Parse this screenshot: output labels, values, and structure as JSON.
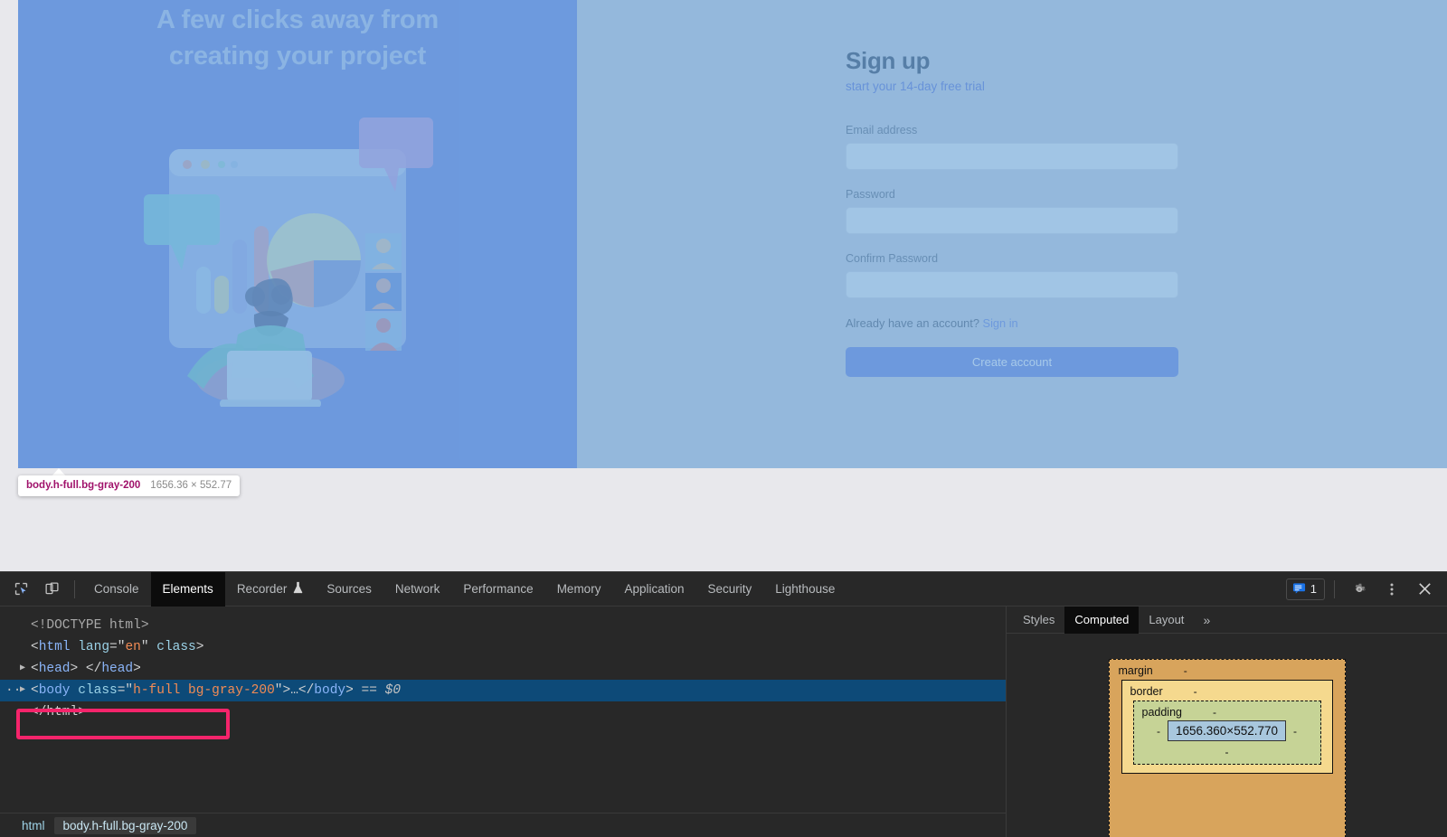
{
  "page": {
    "hero": {
      "title": "A few clicks away from creating your project",
      "illustration_name": "analytics-dashboard-illustration"
    },
    "signup": {
      "title": "Sign up",
      "subtitle": "start your 14-day free trial",
      "email_label": "Email address",
      "email_value": "",
      "email_placeholder": "",
      "password_label": "Password",
      "password_value": "",
      "password_placeholder": "",
      "confirm_label": "Confirm Password",
      "confirm_value": "",
      "confirm_placeholder": "",
      "already_text": "Already have an account?",
      "signin_link": "Sign in",
      "submit_label": "Create account"
    }
  },
  "highlight_tooltip": {
    "selector": "body.h-full.bg-gray-200",
    "dimensions": "1656.36 × 552.77"
  },
  "devtools": {
    "toolbar_icons": [
      "inspect-element-icon",
      "device-toolbar-icon"
    ],
    "tabs": [
      {
        "label": "Console",
        "active": false,
        "icon": ""
      },
      {
        "label": "Elements",
        "active": true,
        "icon": ""
      },
      {
        "label": "Recorder",
        "active": false,
        "icon": "flask-icon"
      },
      {
        "label": "Sources",
        "active": false,
        "icon": ""
      },
      {
        "label": "Network",
        "active": false,
        "icon": ""
      },
      {
        "label": "Performance",
        "active": false,
        "icon": ""
      },
      {
        "label": "Memory",
        "active": false,
        "icon": ""
      },
      {
        "label": "Application",
        "active": false,
        "icon": ""
      },
      {
        "label": "Security",
        "active": false,
        "icon": ""
      },
      {
        "label": "Lighthouse",
        "active": false,
        "icon": ""
      }
    ],
    "message_count": "1",
    "right_icons": [
      "message-icon",
      "settings-gear-icon",
      "more-options-icon",
      "close-icon"
    ],
    "dom": {
      "lines": [
        {
          "indent": 0,
          "twisty": "",
          "ellipsis": "",
          "text": "<!DOCTYPE html>",
          "type": "doctype",
          "selected": false
        },
        {
          "indent": 0,
          "twisty": "",
          "ellipsis": "",
          "text": "<html lang=\"en\" class>",
          "type": "tag",
          "selected": false
        },
        {
          "indent": 1,
          "twisty": "▶",
          "ellipsis": "",
          "text": "<head> </head>",
          "type": "tag",
          "selected": false
        },
        {
          "indent": 1,
          "twisty": "▶",
          "ellipsis": "··",
          "text": "<body class=\"h-full bg-gray-200\">…</body>  == $0",
          "type": "tag",
          "selected": true
        },
        {
          "indent": 0,
          "twisty": "",
          "ellipsis": "",
          "text": "</html>",
          "type": "tag",
          "selected": false
        }
      ],
      "doctype_text": "<!DOCTYPE html>",
      "html_open_tag": "html",
      "html_attr_name": "lang",
      "html_attr_value": "en",
      "html_attr_class": "class",
      "head_tag": "head",
      "body_tag": "body",
      "body_attr_name": "class",
      "body_attr_value": "h-full bg-gray-200",
      "body_suffix": "== $0",
      "html_close": "</html>"
    },
    "annotation": {
      "name": "highlight-rectangle",
      "color": "#f5246b"
    },
    "breadcrumb": [
      {
        "label": "html",
        "active": false
      },
      {
        "label": "body.h-full.bg-gray-200",
        "active": true
      }
    ],
    "sidebar": {
      "tabs": [
        {
          "label": "Styles",
          "active": false
        },
        {
          "label": "Computed",
          "active": true
        },
        {
          "label": "Layout",
          "active": false
        }
      ],
      "more_label": "»",
      "box_model": {
        "margin_label": "margin",
        "margin_value": "-",
        "border_label": "border",
        "border_value": "-",
        "padding_label": "padding",
        "padding_value": "-",
        "content_size": "1656.360×552.770",
        "dash": "-"
      }
    }
  },
  "colors": {
    "hero_bg": "#6b82e0",
    "accent_button": "#6b82e0",
    "link": "#6b82e0",
    "devtools_bg": "#282828",
    "devtools_active_tab": "#0c0c0c",
    "dom_selected_row": "#0d4a78",
    "annotation": "#f5246b",
    "inspect_overlay": "rgba(111,168,220,0.62)",
    "box_margin": "#d8a45c",
    "box_border": "#f5d98e",
    "box_padding": "#c6d396",
    "box_content": "#a8c7dd"
  }
}
